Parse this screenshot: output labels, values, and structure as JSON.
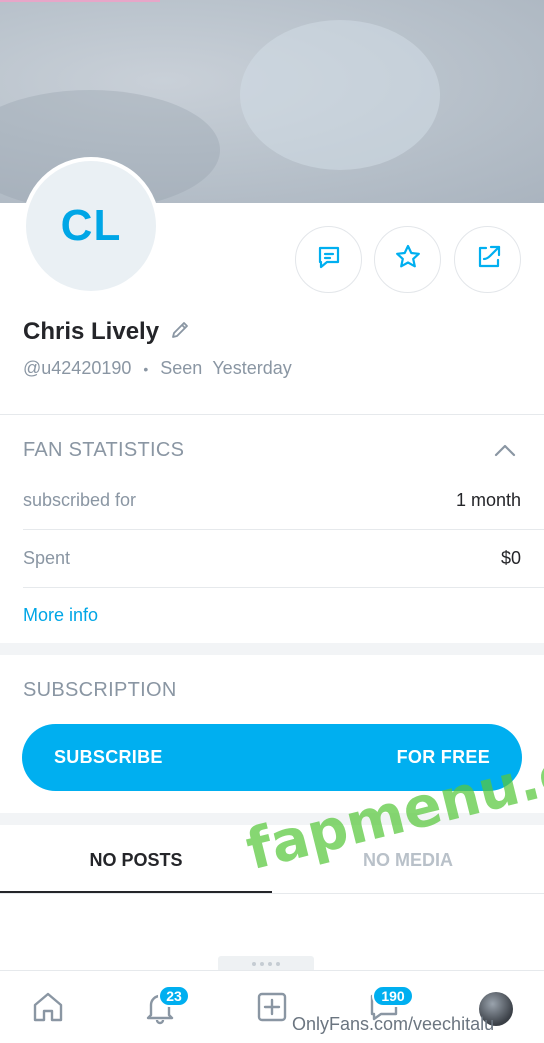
{
  "profile": {
    "initials": "CL",
    "name": "Chris Lively",
    "handle": "@u42420190",
    "separator": "•",
    "seen_label": "Seen",
    "seen_value": "Yesterday"
  },
  "actions": {
    "icons": [
      "message-icon",
      "star-icon",
      "share-icon"
    ]
  },
  "fan_statistics": {
    "title": "FAN STATISTICS",
    "rows": [
      {
        "label": "subscribed for",
        "value": "1 month"
      },
      {
        "label": "Spent",
        "value": "$0"
      }
    ],
    "more_info": "More info"
  },
  "subscription": {
    "title": "SUBSCRIPTION",
    "button_left": "SUBSCRIBE",
    "button_right": "FOR FREE"
  },
  "tabs": [
    {
      "label": "NO POSTS",
      "active": true
    },
    {
      "label": "NO MEDIA",
      "active": false
    }
  ],
  "watermark": "fapmenu.com",
  "bottom_nav": {
    "notifications_count": "23",
    "messages_count": "190",
    "footer_url": "OnlyFans.com/veechitalu"
  },
  "colors": {
    "accent": "#00aff0",
    "link": "#00a6e6",
    "muted": "#8a96a3",
    "text": "#242529"
  }
}
